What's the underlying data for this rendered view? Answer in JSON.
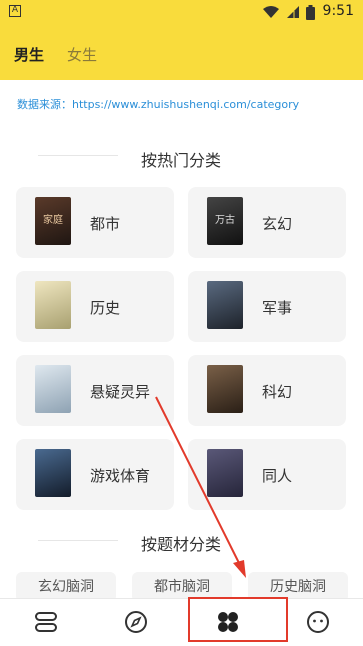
{
  "status_bar": {
    "time": "9:51",
    "app_icon_letter": "A"
  },
  "tabs": [
    {
      "label": "男生"
    },
    {
      "label": "女生"
    }
  ],
  "source_text": "数据来源：https://www.zhuishushenqi.com/category",
  "hot_section": {
    "title": "按热门分类"
  },
  "categories": [
    {
      "label": "都市",
      "cover_color": "#3a2a22",
      "cover_text": "家庭"
    },
    {
      "label": "玄幻",
      "cover_color": "#2a2a2a",
      "cover_text": "万古"
    },
    {
      "label": "历史",
      "cover_color": "#d9cfa0",
      "cover_text": ""
    },
    {
      "label": "军事",
      "cover_color": "#2e3540",
      "cover_text": ""
    },
    {
      "label": "悬疑灵异",
      "cover_color": "#b9c7d3",
      "cover_text": ""
    },
    {
      "label": "科幻",
      "cover_color": "#4a3a2a",
      "cover_text": ""
    },
    {
      "label": "游戏体育",
      "cover_color": "#2a3b55",
      "cover_text": ""
    },
    {
      "label": "同人",
      "cover_color": "#3c3b55",
      "cover_text": ""
    }
  ],
  "topic_section": {
    "title": "按题材分类"
  },
  "topic_chips": [
    {
      "label": "玄幻脑洞"
    },
    {
      "label": "都市脑洞"
    },
    {
      "label": "历史脑洞"
    }
  ],
  "bottom_nav": [
    {
      "icon": "bookshelf-icon"
    },
    {
      "icon": "compass-icon"
    },
    {
      "icon": "category-icon"
    },
    {
      "icon": "profile-icon"
    }
  ],
  "annotation_color": "#e23a2b"
}
